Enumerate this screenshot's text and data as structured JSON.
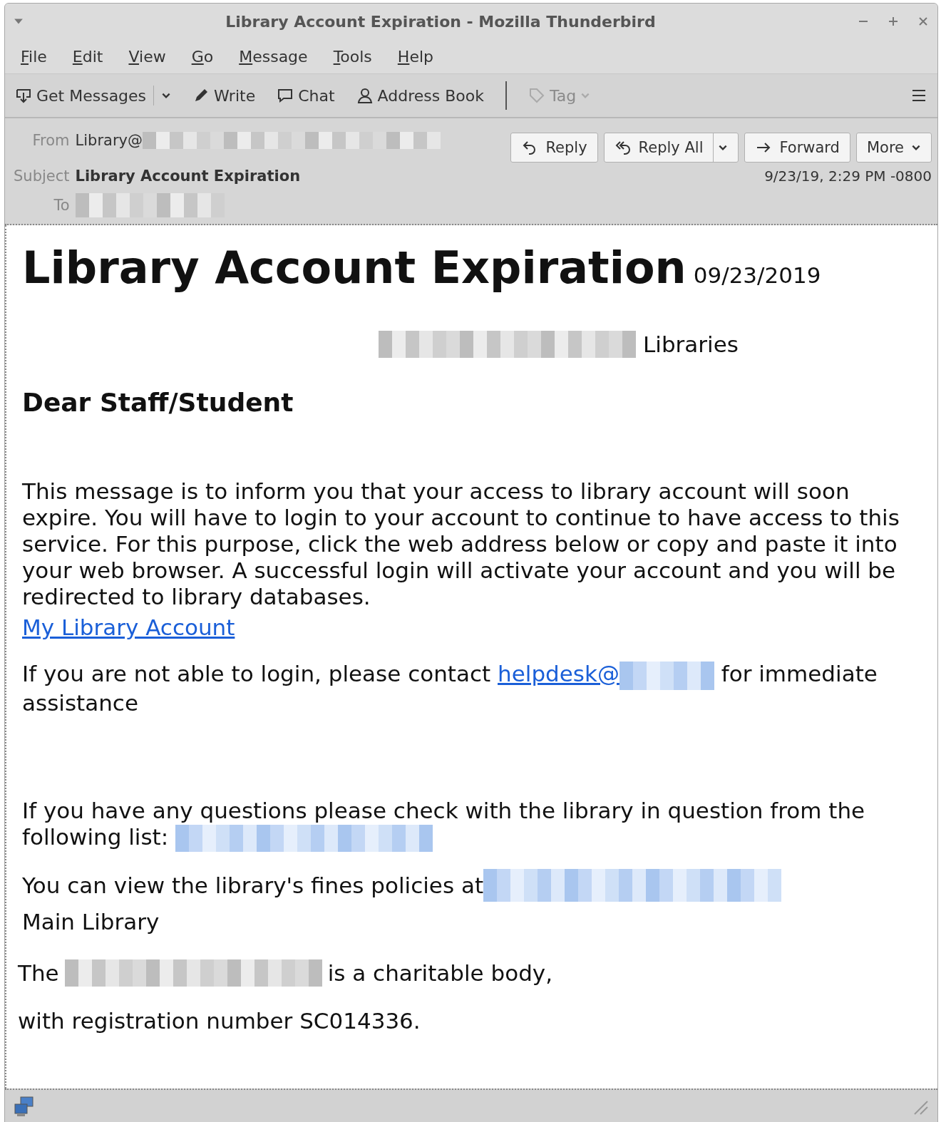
{
  "window": {
    "title": "Library Account Expiration - Mozilla Thunderbird"
  },
  "menu": [
    {
      "label": "File"
    },
    {
      "label": "Edit"
    },
    {
      "label": "View"
    },
    {
      "label": "Go"
    },
    {
      "label": "Message"
    },
    {
      "label": "Tools"
    },
    {
      "label": "Help"
    }
  ],
  "toolbar": [
    {
      "label": "Get Messages",
      "kind": "split",
      "disabled": false
    },
    {
      "label": "Write",
      "kind": "plain",
      "disabled": false
    },
    {
      "label": "Chat",
      "kind": "plain",
      "disabled": false
    },
    {
      "label": "Address Book",
      "kind": "plain",
      "disabled": false
    },
    {
      "label": "Tag",
      "kind": "menu",
      "disabled": true
    }
  ],
  "header": {
    "from_label": "From",
    "from_value": "Library@",
    "from_redacted": true,
    "subject_label": "Subject",
    "subject_value": "Library Account Expiration",
    "to_label": "To",
    "to_redacted": true,
    "date": "9/23/19, 2:29 PM -0800",
    "buttons": [
      {
        "label": "Reply",
        "kind": "plain"
      },
      {
        "label": "Reply All",
        "kind": "split"
      },
      {
        "label": "Forward",
        "kind": "plain"
      },
      {
        "label": "More",
        "kind": "menu"
      }
    ]
  },
  "body": {
    "title": "Library Account Expiration",
    "title_date": "09/23/2019",
    "org": {
      "redacted": true,
      "text": "Libraries"
    },
    "greeting": "Dear Staff/Student",
    "paragraph": "This message is to inform you that your access to library account will soon expire. You will have to login to your account to continue to have access to this service. For this purpose, click the web address below or copy and paste it into your web browser. A successful login will activate your account and you will be redirected to library databases.",
    "link": "My Library Account",
    "contact": {
      "before": "If you are not able to login, please contact ",
      "link": "helpdesk@",
      "redacted": true,
      "after": "for immediate assistance"
    },
    "questions": {
      "text": "If you have any questions please check with the library in question from the following list:",
      "redacted": true
    },
    "fines": {
      "text": "You can view the library's fines policies at",
      "redacted": true
    },
    "signature": "Main Library",
    "charity": {
      "before": "The",
      "redacted": true,
      "after": "is a charitable body,"
    },
    "registration": "with registration number SC014336."
  }
}
